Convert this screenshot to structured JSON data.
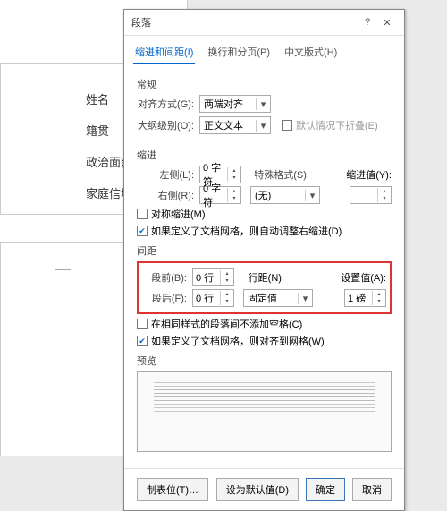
{
  "doc": {
    "labels": [
      "姓名",
      "籍贯",
      "政治面貌",
      "家庭信址"
    ]
  },
  "dialog": {
    "title": "段落",
    "tabs": [
      "缩进和间距(I)",
      "换行和分页(P)",
      "中文版式(H)"
    ],
    "sections": {
      "general": "常规",
      "indent": "缩进",
      "spacing": "间距",
      "preview": "预览"
    },
    "general": {
      "align_label": "对齐方式(G):",
      "align_value": "两端对齐",
      "outline_label": "大纲级别(O):",
      "outline_value": "正文文本",
      "collapse_label": "默认情况下折叠(E)"
    },
    "indent": {
      "left_label": "左侧(L):",
      "left_value": "0 字符",
      "right_label": "右侧(R):",
      "right_value": "0 字符",
      "special_label": "特殊格式(S):",
      "special_value": "(无)",
      "by_label": "缩进值(Y):",
      "by_value": "",
      "mirror": "对称缩进(M)",
      "auto": "如果定义了文档网格，则自动调整右缩进(D)"
    },
    "spacing": {
      "before_label": "段前(B):",
      "before_value": "0 行",
      "after_label": "段后(F):",
      "after_value": "0 行",
      "line_label": "行距(N):",
      "line_value": "固定值",
      "at_label": "设置值(A):",
      "at_value": "1 磅",
      "nospace": "在相同样式的段落间不添加空格(C)",
      "snap": "如果定义了文档网格，则对齐到网格(W)"
    },
    "buttons": {
      "tabs": "制表位(T)…",
      "default": "设为默认值(D)",
      "ok": "确定",
      "cancel": "取消"
    }
  }
}
